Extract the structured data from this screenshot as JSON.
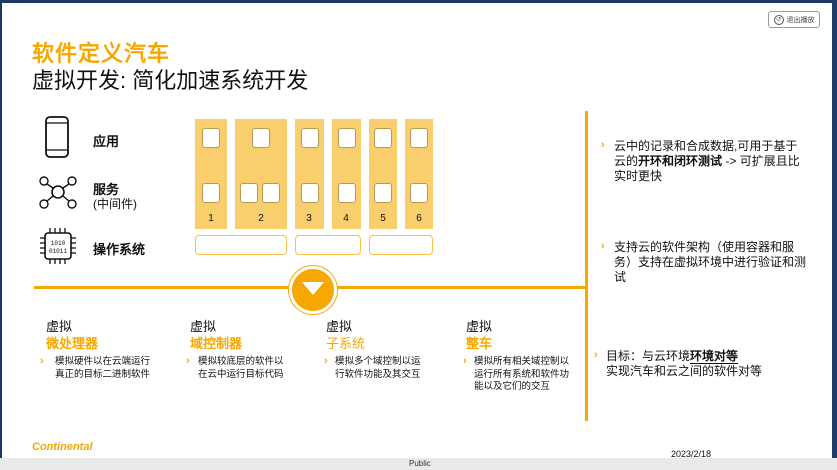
{
  "toolbar": {
    "exit_label": "退出播放"
  },
  "header": {
    "title_line1": "软件定义汽车",
    "title_line2": "虚拟开发: 简化加速系统开发"
  },
  "layers": {
    "app": "应用",
    "service": "服务",
    "service_sub": "(中间件)",
    "os": "操作系统",
    "os_chip_text": "1010\n01011"
  },
  "columns": [
    "1",
    "2",
    "3",
    "4",
    "5",
    "6"
  ],
  "stages": [
    {
      "line1": "虚拟",
      "line2": "微处理器",
      "desc": "模拟硬件以在云端运行真正的目标二进制软件"
    },
    {
      "line1": "虚拟",
      "line2": "域控制器",
      "desc": "模拟较底层的软件以在云中运行目标代码"
    },
    {
      "line1": "虚拟",
      "line2": "子系统",
      "desc": "模拟多个域控制以运行软件功能及其交互"
    },
    {
      "line1": "虚拟",
      "line2": "整车",
      "desc": "模拟所有相关域控制以运行所有系统和软件功能以及它们的交互"
    }
  ],
  "right_points": {
    "p1_a": "云中的记录和合成数据,可用于基于云的",
    "p1_bold": "开环和闭环测试",
    "p1_b": " -> 可扩展且比实时更快",
    "p2": "支持云的软件架构（使用容器和服务）支持在虚拟环境中进行验证和测试",
    "p3_a": "目标：与云环境",
    "p3_bold": "环境对等",
    "p3_b": "实现汽车和云之间的软件对等"
  },
  "footer": {
    "brand": "Continental",
    "date": "2023/2/18",
    "classification": "Public"
  },
  "colors": {
    "accent": "#f6a800",
    "column_fill": "#f9cf6e",
    "frame": "#1e3a66"
  }
}
